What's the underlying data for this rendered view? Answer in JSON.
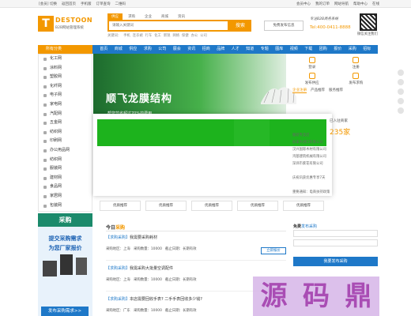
{
  "topbar": {
    "left": [
      "[会员] 切换",
      "返回首页",
      "手机版",
      "订单查询",
      "二维码"
    ],
    "right": [
      "会员中心",
      "我的订单",
      "网站导航",
      "帮助中心",
      "在线"
    ]
  },
  "logo": {
    "mark": "T",
    "name": "DESTOON",
    "sub": "B2B网站管理系统"
  },
  "search": {
    "tabs": [
      "供应",
      "求购",
      "企业",
      "商城",
      "资讯"
    ],
    "active_tab": 0,
    "placeholder": "请输入关键词",
    "button": "搜索",
    "hot_label": "关键词：",
    "hot": [
      "手机",
      "连衣裙",
      "行车",
      "化工",
      "新锐",
      "网络",
      "保健",
      "办公",
      "公司"
    ]
  },
  "header": {
    "free_button": "免费发布信息",
    "slogan_1": "专注B2B商务系统",
    "slogan_2": "Tel:400-0411-8888",
    "qr_label": "微信关注我们"
  },
  "nav": {
    "category_label": "所有分类",
    "items": [
      "首页",
      "商城",
      "供应",
      "求购",
      "公司",
      "展会",
      "资讯",
      "招商",
      "品牌",
      "人才",
      "知道",
      "专题",
      "图库",
      "视频",
      "下载",
      "团购",
      "报价",
      "采购",
      "招标",
      "论坛",
      "更多"
    ]
  },
  "sidebar": {
    "items": [
      "化工网",
      "涂料网",
      "塑胶网",
      "化纤网",
      "电子网",
      "家电网",
      "汽配网",
      "五金网",
      "纺织网",
      "印刷网",
      "办公用品网",
      "纺织网",
      "服装网",
      "建材网",
      "食品网",
      "家居网",
      "包装网"
    ]
  },
  "banner": {
    "title": "顺飞龙膜结构",
    "subtitle": "帮您节省超过70%的费用"
  },
  "thumbs": [
    "优质推荐",
    "优质推荐",
    "优质推荐",
    "优质推荐",
    "优质推荐"
  ],
  "right_panel": {
    "tabs": [
      "登录",
      "注册",
      "发布供应",
      "发布求购"
    ],
    "subtabs": [
      "企业注册",
      "产品推荐",
      "服务推荐"
    ],
    "stat_label": "已入驻商家",
    "stat_value": "235家",
    "list": [
      "服装专卖店",
      "加拿大进口有限公司",
      "汉兴国际木材有限公司",
      "鸿基建筑机械有限公司",
      "深圳市紫花有限公司",
      "",
      "庆祝讯获优惠专享7天",
      "",
      "重要通知：电商扶持政策"
    ]
  },
  "ad": {
    "header": "采购",
    "line1": "提交采购需求",
    "line2": "为您厂家报价",
    "footer": "发布采购需求>>"
  },
  "today": {
    "prefix": "今日",
    "highlight": "采购",
    "items": [
      {
        "tag": "【求购采购】",
        "title": "我需要采购耗材",
        "region": "采购地区：上海",
        "qty": "采购数量：10000",
        "deadline": "截止日期：长期有效",
        "button": "立即报价"
      },
      {
        "tag": "【求购采购】",
        "title": "我需采购大批量空调配件",
        "region": "采购地区：上海",
        "qty": "采购数量：10000",
        "deadline": "截止日期：长期有效",
        "button": ""
      },
      {
        "tag": "【求购采购】",
        "title": "本店需要回收手表? 二手手表回收多少钱?",
        "region": "采购地区：广东",
        "qty": "采购数量：10000",
        "deadline": "截止日期：长期有效",
        "button": ""
      }
    ]
  },
  "free_post": {
    "prefix": "免费",
    "highlight": "发布采购",
    "button": "我要发布采购"
  },
  "watermark": [
    "源",
    "码",
    "鼎"
  ]
}
